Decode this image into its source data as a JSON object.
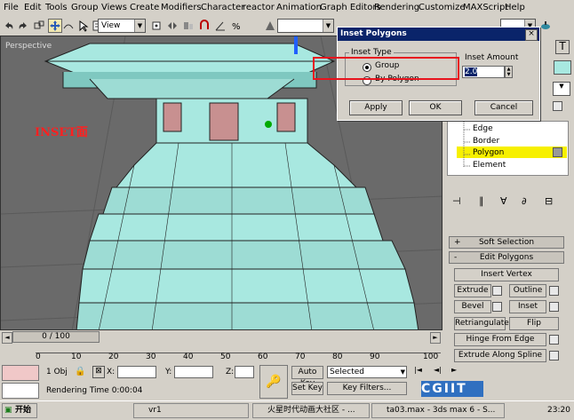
{
  "menu": [
    "File",
    "Edit",
    "Tools",
    "Group",
    "Views",
    "Create",
    "Modifiers",
    "Character",
    "reactor",
    "Animation",
    "Graph Editors",
    "Rendering",
    "Customize",
    "MAXScript",
    "Help"
  ],
  "toolbar": {
    "view_combo": "View"
  },
  "viewport": {
    "label": "Perspective",
    "annotation": "INSET面"
  },
  "dialog": {
    "title": "Inset Polygons",
    "close": "×",
    "inset_type_label": "Inset Type",
    "option_group": "Group",
    "option_by_polygon": "By Polygon",
    "inset_amount_label": "Inset Amount",
    "inset_amount_value": "2.0",
    "apply": "Apply",
    "ok": "OK",
    "cancel": "Cancel"
  },
  "selection_levels": {
    "edge": "Edge",
    "border": "Border",
    "polygon": "Polygon",
    "element": "Element"
  },
  "rollouts": {
    "soft_selection": "Soft Selection",
    "edit_polygons": "Edit Polygons"
  },
  "buttons": {
    "insert_vertex": "Insert Vertex",
    "extrude": "Extrude",
    "outline": "Outline",
    "bevel": "Bevel",
    "inset": "Inset",
    "retriangulate": "Retriangulate",
    "flip": "Flip",
    "hinge_from_edge": "Hinge From Edge",
    "extrude_along_spline": "Extrude Along Spline"
  },
  "timeline": {
    "frame": "0 / 100",
    "ticks": [
      "0",
      "10",
      "20",
      "30",
      "40",
      "50",
      "60",
      "70",
      "80",
      "90",
      "100"
    ]
  },
  "status": {
    "objects": "1 Obj",
    "x_label": "X:",
    "y_label": "Y:",
    "z_label": "Z:",
    "rendering_time": "Rendering Time  0:00:04",
    "auto_key": "Auto Key",
    "selected": "Selected",
    "set_key": "Set Key",
    "key_filters": "Key Filters..."
  },
  "taskbar": {
    "start": "开始",
    "items": [
      "vr1",
      "火星时代动画大社区 - ...",
      "ta03.max - 3ds max 6 - S..."
    ],
    "time": "23:20"
  },
  "watermark": "CGIIT",
  "colors": {
    "selection_yellow": "#f7f000",
    "highlight_red": "#e8141e",
    "mesh_cyan": "#a8e8e0",
    "dialog_title": "#0a246a"
  }
}
